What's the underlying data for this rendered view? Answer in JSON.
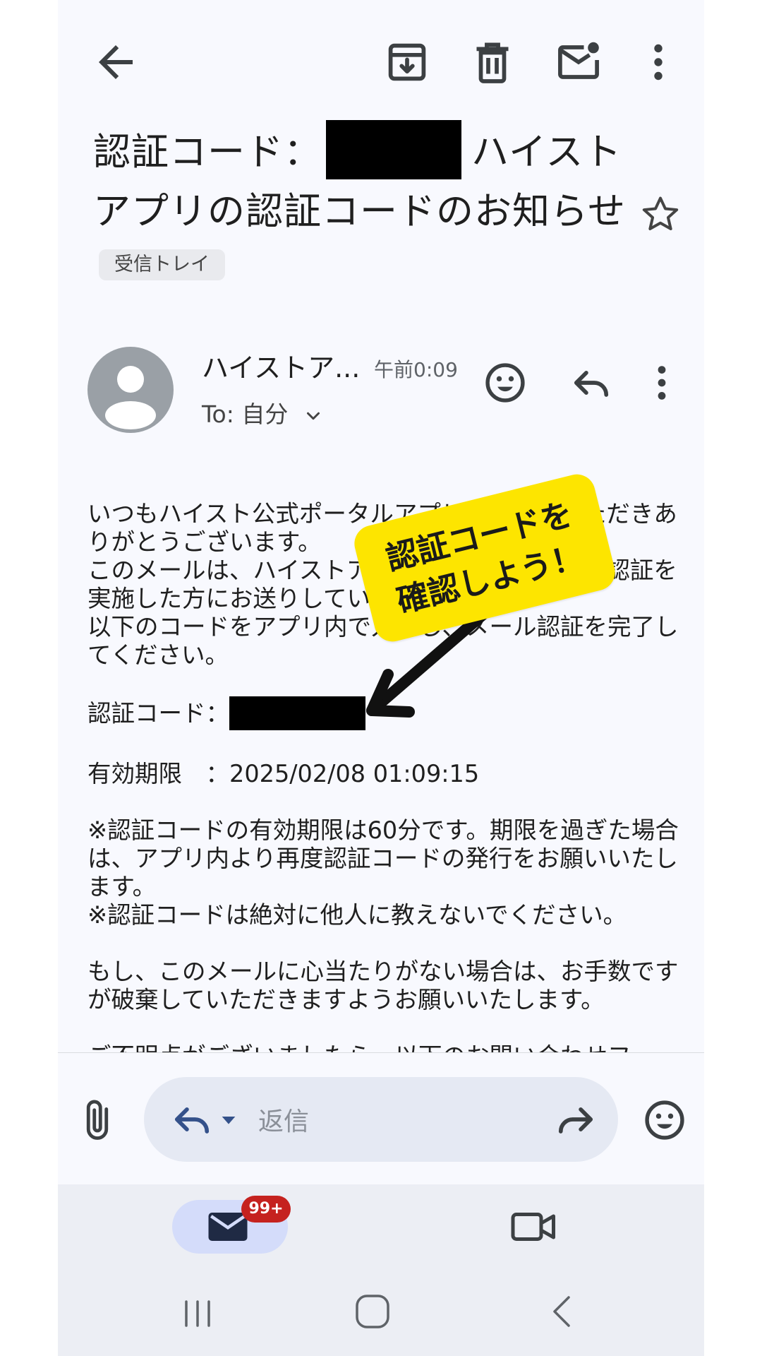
{
  "subject": {
    "prefix": "認証コード：",
    "rest": "ハイストアプリの認証コードのお知らせ",
    "label_chip": "受信トレイ"
  },
  "sender": {
    "name": "ハイストア...",
    "time": "午前0:09",
    "to": "To: 自分"
  },
  "body": {
    "greeting_1": "いつもハイスト公式ポータルアプリをご利用いただきありがとうございます。",
    "greeting_2": "このメールは、ハイストアプリでメールアドレス認証を実施した方にお送りしています。",
    "greeting_3": "以下のコードをアプリ内で入力し、メール認証を完了してください。",
    "code_label": "認証コード：",
    "expiry_label": "有効期限　：",
    "expiry_value": "2025/02/08 01:09:15",
    "note_1": "※認証コードの有効期限は60分です。期限を過ぎた場合は、アプリ内より再度認証コードの発行をお願いいたします。",
    "note_2": "※認証コードは絶対に他人に教えないでください。",
    "closing": "もし、このメールに心当たりがない場合は、お手数ですが破棄していただきますようお願いいたします。"
  },
  "callout": {
    "line1": "認証コードを",
    "line2": "確認しよう！",
    "color": "#fde500"
  },
  "reply_bar": {
    "placeholder": "返信"
  },
  "bottom_nav": {
    "mail_badge": "99+"
  },
  "icons": [
    "back-arrow-icon",
    "archive-icon",
    "trash-icon",
    "mark-unread-icon",
    "more-vert-icon",
    "star-icon",
    "emoji-icon",
    "reply-icon",
    "attach-icon",
    "forward-icon",
    "mail-icon",
    "video-icon"
  ]
}
